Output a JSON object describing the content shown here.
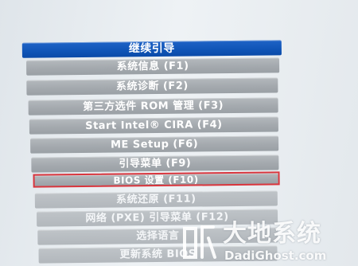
{
  "menu": {
    "items": [
      {
        "label": "继续引导",
        "state": "selected"
      },
      {
        "label": "系统信息 (F1)",
        "state": "normal"
      },
      {
        "label": "系统诊断 (F2)",
        "state": "normal"
      },
      {
        "label": "第三方选件 ROM 管理 (F3)",
        "state": "normal"
      },
      {
        "label": "Start Intel® CIRA (F4)",
        "state": "normal"
      },
      {
        "label": "ME Setup (F6)",
        "state": "normal"
      },
      {
        "label": "引导菜单 (F9)",
        "state": "normal"
      },
      {
        "label": "BIOS 设置 (F10)",
        "state": "highlighted"
      },
      {
        "label": "系统还原 (F11)",
        "state": "normal"
      },
      {
        "label": "网络 (PXE) 引导菜单 (F12)",
        "state": "normal"
      },
      {
        "label": "选择语言",
        "state": "normal"
      },
      {
        "label": "更新系统 BIOS",
        "state": "normal"
      }
    ]
  },
  "annotation": {
    "highlight_color": "#d9353d",
    "highlighted_item": "BIOS 设置 (F10)"
  },
  "watermark": {
    "title": "大地系统",
    "url": "DadiGhost.com",
    "logo_icon": "dadi-logo-icon"
  },
  "colors": {
    "selected_bg": "#0f54b6",
    "item_bg": "#a4a9ae",
    "text": "#ffffff"
  }
}
